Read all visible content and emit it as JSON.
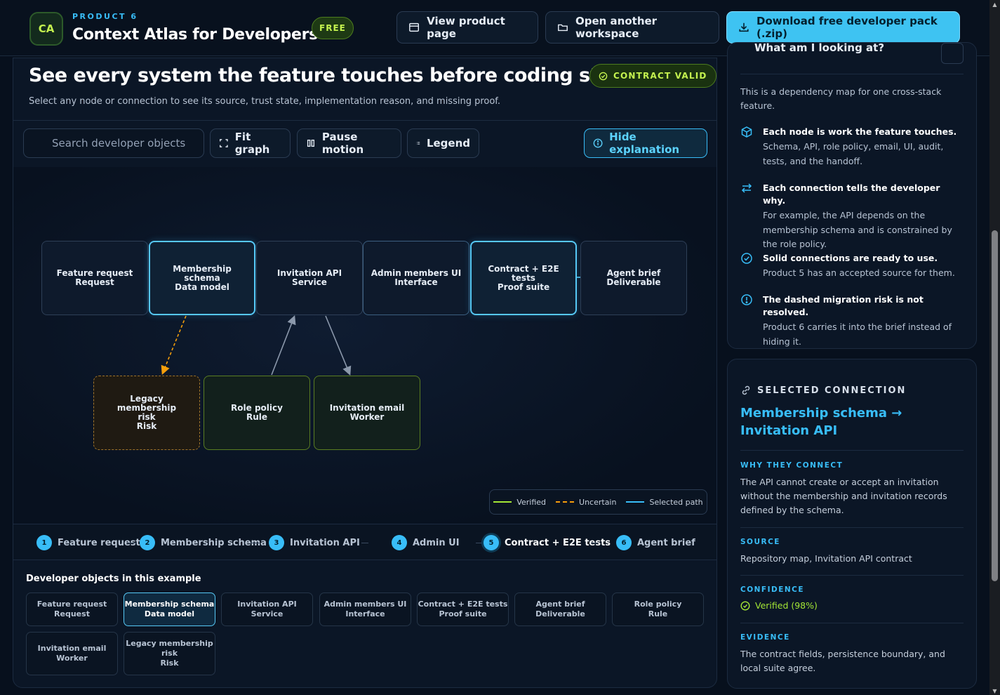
{
  "header": {
    "logo": "CA",
    "kicker": "PRODUCT 6",
    "title": "Context Atlas for Developers",
    "free_badge": "FREE",
    "buttons": {
      "view_product": "View product page",
      "open_workspace": "Open another workspace",
      "download": "Download free developer pack (.zip)"
    }
  },
  "main": {
    "title": "See every system the feature touches before coding starts",
    "subtitle": "Select any node or connection to see its source, trust state, implementation reason, and missing proof.",
    "contract_badge": "CONTRACT VALID",
    "toolbar": {
      "search_placeholder": "Search developer objects",
      "fit_graph": "Fit graph",
      "pause_motion": "Pause motion",
      "legend": "Legend",
      "hide_explanation": "Hide explanation"
    },
    "graph": {
      "nodes": [
        {
          "line1": "Feature request",
          "line2": "Request"
        },
        {
          "line1": "Membership schema",
          "line2": "Data model"
        },
        {
          "line1": "Invitation API",
          "line2": "Service"
        },
        {
          "line1": "Admin members UI",
          "line2": "Interface"
        },
        {
          "line1": "Contract + E2E tests",
          "line2": "Proof suite"
        },
        {
          "line1": "Agent brief",
          "line2": "Deliverable"
        },
        {
          "line1": "Legacy membership",
          "line2": "risk",
          "line3": "Risk"
        },
        {
          "line1": "Role policy",
          "line2": "Rule"
        },
        {
          "line1": "Invitation email",
          "line2": "Worker"
        }
      ],
      "legend": {
        "verified": "Verified",
        "uncertain": "Uncertain",
        "selected": "Selected path"
      },
      "colors": {
        "verified": "#a3e635",
        "uncertain": "#f59e0b",
        "selected": "#38bdf8"
      }
    },
    "steps": [
      {
        "num": "1",
        "label": "Feature request"
      },
      {
        "num": "2",
        "label": "Membership schema"
      },
      {
        "num": "3",
        "label": "Invitation API"
      },
      {
        "num": "4",
        "label": "Admin UI"
      },
      {
        "num": "5",
        "label": "Contract + E2E tests"
      },
      {
        "num": "6",
        "label": "Agent brief"
      }
    ],
    "objects_title": "Developer objects in this example",
    "objects": [
      {
        "line1": "Feature request",
        "line2": "Request"
      },
      {
        "line1": "Membership schema",
        "line2": "Data model"
      },
      {
        "line1": "Invitation API",
        "line2": "Service"
      },
      {
        "line1": "Admin members UI",
        "line2": "Interface"
      },
      {
        "line1": "Contract + E2E tests",
        "line2": "Proof suite"
      },
      {
        "line1": "Agent brief",
        "line2": "Deliverable"
      },
      {
        "line1": "Role policy",
        "line2": "Rule"
      },
      {
        "line1": "Invitation email",
        "line2": "Worker"
      },
      {
        "line1": "Legacy membership",
        "line2": "risk",
        "line3": "Risk"
      }
    ]
  },
  "explanation": {
    "header": "What am I looking at?",
    "intro": "This is a dependency map for one cross-stack feature.",
    "items": [
      {
        "title": "Each node is work the feature touches.",
        "body": "Schema, API, role policy, email, UI, audit, tests, and the handoff."
      },
      {
        "title": "Each connection tells the developer why.",
        "body": "For example, the API depends on the membership schema and is constrained by the role policy."
      },
      {
        "title": "Solid connections are ready to use.",
        "body": "Product 5 has an accepted source for them."
      },
      {
        "title": "The dashed migration risk is not resolved.",
        "body": "Product 6 carries it into the brief instead of hiding it."
      }
    ]
  },
  "selected": {
    "kicker": "SELECTED CONNECTION",
    "title": "Membership schema → Invitation API",
    "why_label": "WHY THEY CONNECT",
    "why_text": "The API cannot create or accept an invitation without the membership and invitation records defined by the schema.",
    "source_label": "SOURCE",
    "source_text": "Repository map, Invitation API contract",
    "confidence_label": "CONFIDENCE",
    "confidence_text": "Verified (98%)",
    "evidence_label": "EVIDENCE",
    "evidence_text": "The contract fields, persistence boundary, and local suite agree."
  }
}
